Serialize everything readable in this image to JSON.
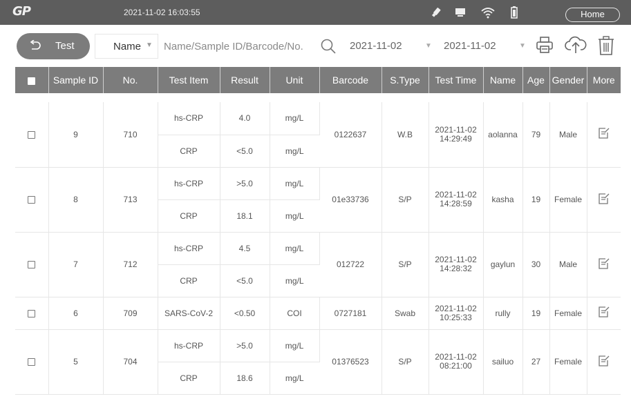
{
  "statusbar": {
    "logo": "GP",
    "datetime": "2021-11-02 16:03:55",
    "icons": [
      "usb-icon",
      "monitor-icon",
      "wifi-icon",
      "battery-icon"
    ],
    "home_label": "Home"
  },
  "toolbar": {
    "test_label": "Test",
    "name_select": "Name",
    "search_placeholder": "Name/Sample ID/Barcode/No.",
    "date_from": "2021-11-02",
    "date_to": "2021-11-02",
    "icons": [
      "search-icon",
      "print-icon",
      "upload-cloud-icon",
      "delete-icon"
    ]
  },
  "table": {
    "headers": [
      "Sample ID",
      "No.",
      "Test Item",
      "Result",
      "Unit",
      "Barcode",
      "S.Type",
      "Test Time",
      "Name",
      "Age",
      "Gender",
      "More"
    ],
    "rows": [
      {
        "sample_id": "9",
        "no": "710",
        "tests": [
          {
            "item": "hs-CRP",
            "result": "4.0",
            "unit": "mg/L"
          },
          {
            "item": "CRP",
            "result": "<5.0",
            "unit": "mg/L"
          }
        ],
        "barcode": "0122637",
        "stype": "W.B",
        "date": "2021-11-02",
        "time": "14:29:49",
        "name": "aolanna",
        "age": "79",
        "gender": "Male"
      },
      {
        "sample_id": "8",
        "no": "713",
        "tests": [
          {
            "item": "hs-CRP",
            "result": ">5.0",
            "unit": "mg/L"
          },
          {
            "item": "CRP",
            "result": "18.1",
            "unit": "mg/L"
          }
        ],
        "barcode": "01e33736",
        "stype": "S/P",
        "date": "2021-11-02",
        "time": "14:28:59",
        "name": "kasha",
        "age": "19",
        "gender": "Female"
      },
      {
        "sample_id": "7",
        "no": "712",
        "tests": [
          {
            "item": "hs-CRP",
            "result": "4.5",
            "unit": "mg/L"
          },
          {
            "item": "CRP",
            "result": "<5.0",
            "unit": "mg/L"
          }
        ],
        "barcode": "012722",
        "stype": "S/P",
        "date": "2021-11-02",
        "time": "14:28:32",
        "name": "gaylun",
        "age": "30",
        "gender": "Male"
      },
      {
        "sample_id": "6",
        "no": "709",
        "tests": [
          {
            "item": "SARS-CoV-2",
            "result": "<0.50",
            "unit": "COI"
          }
        ],
        "barcode": "0727181",
        "stype": "Swab",
        "date": "2021-11-02",
        "time": "10:25:33",
        "name": "rully",
        "age": "19",
        "gender": "Female"
      },
      {
        "sample_id": "5",
        "no": "704",
        "tests": [
          {
            "item": "hs-CRP",
            "result": ">5.0",
            "unit": "mg/L"
          },
          {
            "item": "CRP",
            "result": "18.6",
            "unit": "mg/L"
          }
        ],
        "barcode": "01376523",
        "stype": "S/P",
        "date": "2021-11-02",
        "time": "08:21:00",
        "name": "sailuo",
        "age": "27",
        "gender": "Female"
      }
    ]
  }
}
